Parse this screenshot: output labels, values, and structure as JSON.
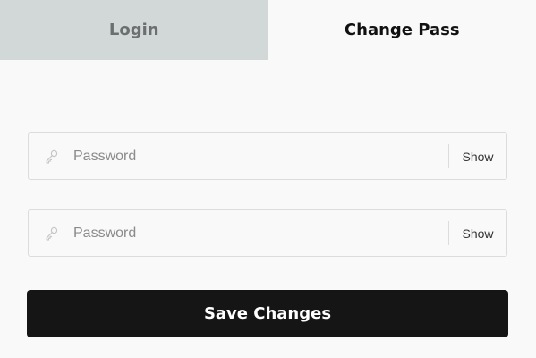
{
  "tabs": [
    {
      "label": "Login",
      "state": "inactive"
    },
    {
      "label": "Change Pass",
      "state": "active"
    }
  ],
  "form": {
    "fields": [
      {
        "icon": "key-icon",
        "value": "",
        "placeholder": "Password",
        "toggle_label": "Show"
      },
      {
        "icon": "key-icon",
        "value": "",
        "placeholder": "Password",
        "toggle_label": "Show"
      }
    ],
    "submit_label": "Save Changes"
  },
  "colors": {
    "page_background": "#f9f9f9",
    "inactive_tab_background": "#d2d7d7",
    "inactive_tab_text": "#6b6f70",
    "active_tab_text": "#111111",
    "field_border": "#dcdcdc",
    "placeholder": "#8b8b8b",
    "button_background": "#151515",
    "button_text": "#ffffff"
  }
}
